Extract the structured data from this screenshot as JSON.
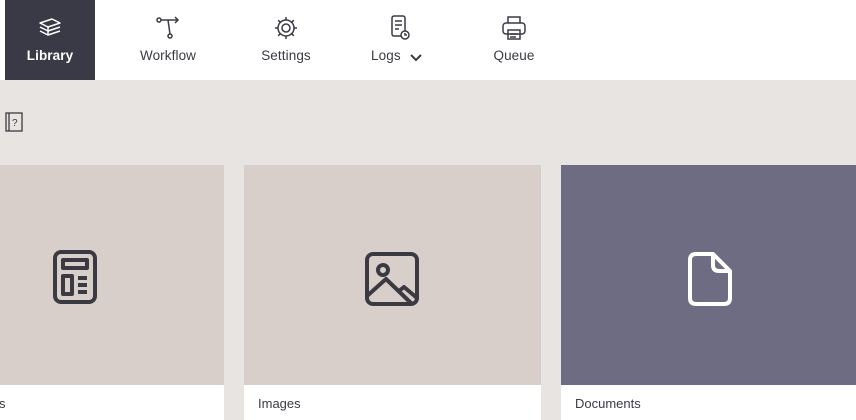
{
  "nav": {
    "items": [
      {
        "label": "Library",
        "icon": "library-icon",
        "active": true
      },
      {
        "label": "Workflow",
        "icon": "workflow-icon",
        "active": false
      },
      {
        "label": "Settings",
        "icon": "gear-icon",
        "active": false
      },
      {
        "label": "Logs",
        "icon": "logs-icon",
        "active": false,
        "has_dropdown": true
      },
      {
        "label": "Queue",
        "icon": "printer-icon",
        "active": false
      }
    ]
  },
  "cards": [
    {
      "label": "s",
      "icon": "template-icon",
      "thumb_color": "#d8cfca"
    },
    {
      "label": "Images",
      "icon": "image-icon",
      "thumb_color": "#d8cfca"
    },
    {
      "label": "Documents",
      "icon": "document-icon",
      "thumb_color": "#6e6c83"
    }
  ],
  "colors": {
    "active_nav_bg": "#3a3946",
    "page_bg": "#e8e4e1",
    "card_thumb_light": "#d8cfca",
    "card_thumb_dark": "#6e6c83",
    "icon_dark": "#3b3a42"
  }
}
